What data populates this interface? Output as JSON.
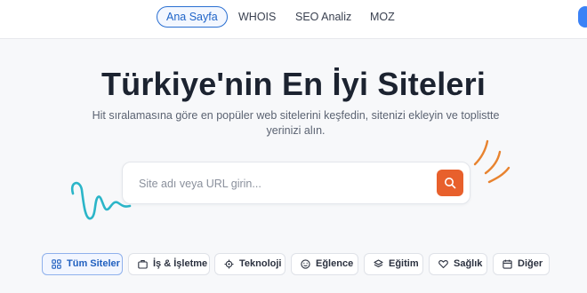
{
  "nav": {
    "items": [
      {
        "label": "Ana Sayfa",
        "active": true
      },
      {
        "label": "WHOIS",
        "active": false
      },
      {
        "label": "SEO Analiz",
        "active": false
      },
      {
        "label": "MOZ",
        "active": false
      }
    ]
  },
  "hero": {
    "title": "Türkiye'nin En İyi Siteleri",
    "subtitle": "Hit sıralamasına göre en popüler web sitelerini keşfedin, sitenizi ekleyin ve toplistte yerinizi alın."
  },
  "search": {
    "placeholder": "Site adı veya URL girin...",
    "value": "",
    "button_icon": "search-icon"
  },
  "categories": [
    {
      "label": "Tüm Siteler",
      "icon": "grid-icon",
      "active": true
    },
    {
      "label": "İş & İşletme",
      "icon": "briefcase-icon",
      "active": false
    },
    {
      "label": "Teknoloji",
      "icon": "gear-icon",
      "active": false
    },
    {
      "label": "Eğlence",
      "icon": "smile-icon",
      "active": false
    },
    {
      "label": "Eğitim",
      "icon": "layers-icon",
      "active": false
    },
    {
      "label": "Sağlık",
      "icon": "heart-icon",
      "active": false
    },
    {
      "label": "Diğer",
      "icon": "calendar-icon",
      "active": false
    }
  ],
  "colors": {
    "accent_blue": "#2a6fd1",
    "search_button": "#e8602c",
    "doodle_teal": "#2bb5c8",
    "doodle_orange": "#e8832f"
  }
}
